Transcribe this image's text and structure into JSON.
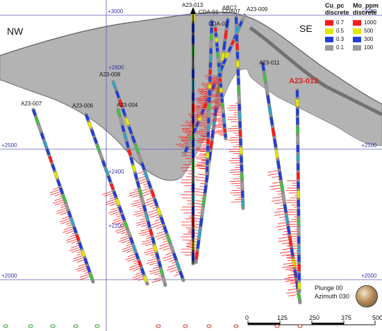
{
  "section": {
    "left_direction": "NW",
    "right_direction": "SE",
    "elevation_labels": [
      "+3000",
      "+2800",
      "+2500",
      "+2400",
      "+2200",
      "+2000"
    ],
    "view": {
      "plunge": "Plunge 00",
      "azimuth": "Azimuth 030"
    }
  },
  "legend": {
    "cu": {
      "title_lines": [
        "Cu_pc",
        "discrete"
      ],
      "classes": [
        {
          "value": "0.7",
          "color": "#ff1a1a"
        },
        {
          "value": "0.5",
          "color": "#e6e600"
        },
        {
          "value": "0.3",
          "color": "#1f3fd6"
        },
        {
          "value": "0.1",
          "color": "#9a9a9a"
        }
      ]
    },
    "mo": {
      "title_lines": [
        "Mo_ppm",
        "discrete"
      ],
      "classes": [
        {
          "value": "1000",
          "color": "#ff1a1a"
        },
        {
          "value": "500",
          "color": "#e6e600"
        },
        {
          "value": "300",
          "color": "#1f3fd6"
        },
        {
          "value": "100",
          "color": "#9a9a9a"
        }
      ]
    }
  },
  "drillholes": [
    {
      "id": "A23-007",
      "highlight": false
    },
    {
      "id": "A23-006",
      "highlight": false
    },
    {
      "id": "A23-008",
      "highlight": false
    },
    {
      "id": "A23-004",
      "highlight": false
    },
    {
      "id": "A23-013",
      "highlight": false
    },
    {
      "id": "ABC7",
      "highlight": false
    },
    {
      "id": "A23-009",
      "highlight": false
    },
    {
      "id": "CDA-01",
      "highlight": false
    },
    {
      "id": "CDA-02",
      "highlight": false
    },
    {
      "id": "CDA07",
      "highlight": false
    },
    {
      "id": "A23-011",
      "highlight": false
    },
    {
      "id": "A23-012",
      "highlight": true
    }
  ],
  "scale_bar": {
    "ticks": [
      "0",
      "125",
      "250",
      "375",
      "500"
    ]
  }
}
